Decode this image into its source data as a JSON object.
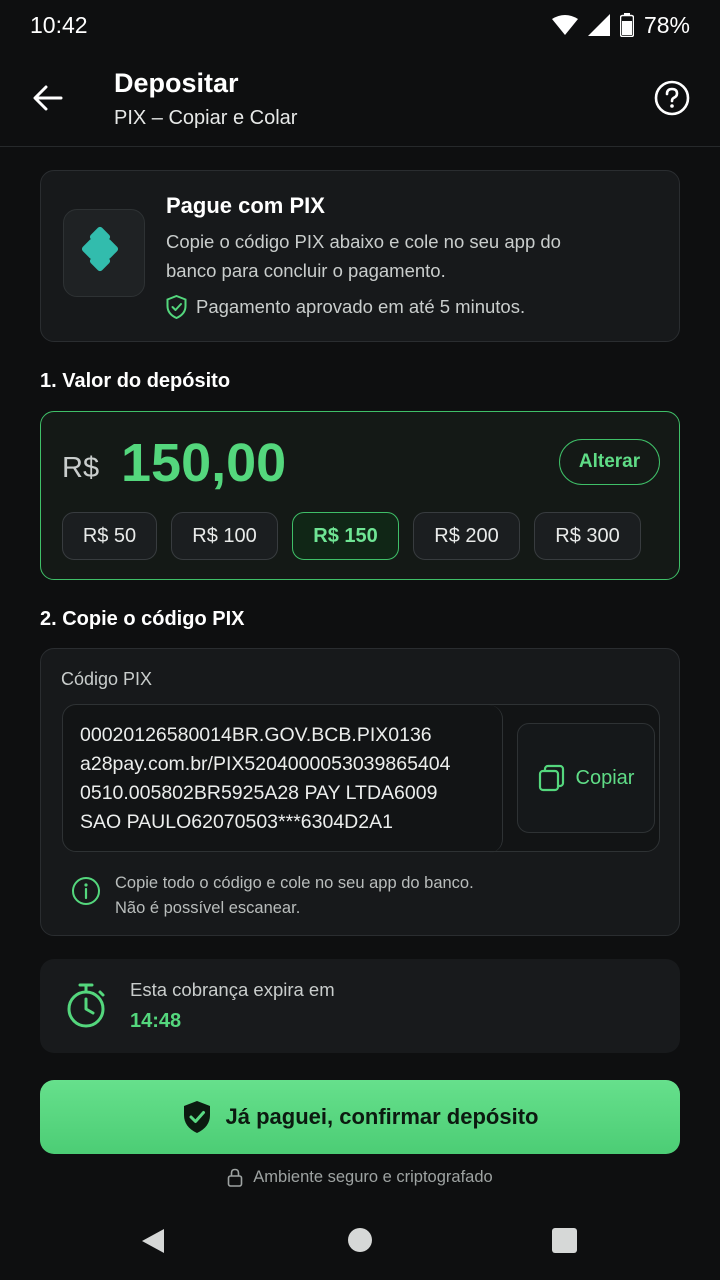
{
  "status_bar": {
    "time": "10:42",
    "battery": "78%"
  },
  "header": {
    "title": "Depositar",
    "subtitle": "PIX – Copiar e Colar",
    "back_icon": "arrow-left-icon",
    "help_icon": "help-circle-icon"
  },
  "pix_card": {
    "title": "Pague com PIX",
    "description": "Copie o código PIX abaixo e cole no seu app do banco para concluir o pagamento.",
    "approved": "Pagamento aprovado em até 5 minutos."
  },
  "amount_section": {
    "label": "1. Valor do depósito",
    "currency": "R$",
    "value": "150,00",
    "alter_label": "Alterar",
    "chips": [
      "R$ 50",
      "R$ 100",
      "R$ 150",
      "R$ 200",
      "R$ 300"
    ],
    "selected_chip": "R$ 150"
  },
  "code_section": {
    "label": "2. Copie o código PIX",
    "field_label": "Código PIX",
    "code": "00020126580014BR.GOV.BCB.PIX0136\na28pay.com.br/PIX5204000053039865404\n0510.005802BR5925A28 PAY LTDA6009\nSAO PAULO62070503***6304D2A1",
    "copy_label": "Copiar",
    "hint": "Copie todo o código e cole no seu app do banco.\nNão é possível escanear."
  },
  "timer": {
    "label": "Esta cobrança expira em",
    "value": "14:48"
  },
  "confirm_button": {
    "label": "Já paguei, confirmar depósito"
  },
  "secure_note": "Ambiente seguro e criptografado",
  "colors": {
    "accent": "#54d77d",
    "background": "#0e0f10",
    "card": "#17191b",
    "pix_teal": "#32bcad"
  }
}
